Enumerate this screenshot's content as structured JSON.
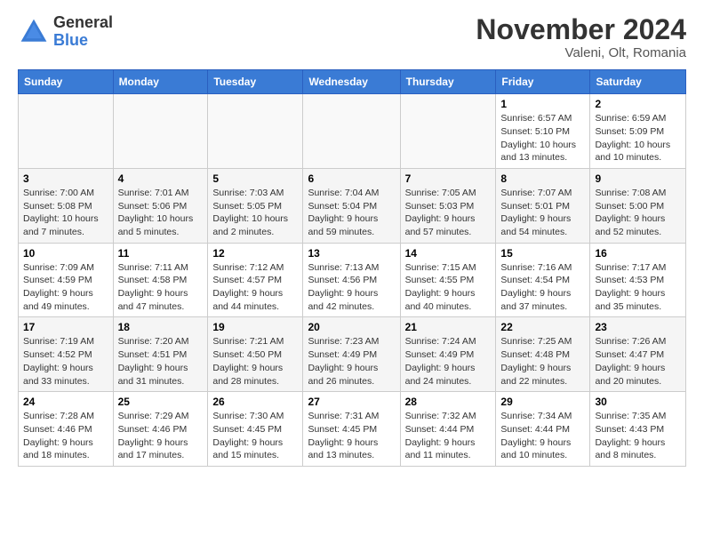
{
  "header": {
    "logo_general": "General",
    "logo_blue": "Blue",
    "month_title": "November 2024",
    "location": "Valeni, Olt, Romania"
  },
  "weekdays": [
    "Sunday",
    "Monday",
    "Tuesday",
    "Wednesday",
    "Thursday",
    "Friday",
    "Saturday"
  ],
  "weeks": [
    [
      {
        "day": "",
        "info": ""
      },
      {
        "day": "",
        "info": ""
      },
      {
        "day": "",
        "info": ""
      },
      {
        "day": "",
        "info": ""
      },
      {
        "day": "",
        "info": ""
      },
      {
        "day": "1",
        "info": "Sunrise: 6:57 AM\nSunset: 5:10 PM\nDaylight: 10 hours and 13 minutes."
      },
      {
        "day": "2",
        "info": "Sunrise: 6:59 AM\nSunset: 5:09 PM\nDaylight: 10 hours and 10 minutes."
      }
    ],
    [
      {
        "day": "3",
        "info": "Sunrise: 7:00 AM\nSunset: 5:08 PM\nDaylight: 10 hours and 7 minutes."
      },
      {
        "day": "4",
        "info": "Sunrise: 7:01 AM\nSunset: 5:06 PM\nDaylight: 10 hours and 5 minutes."
      },
      {
        "day": "5",
        "info": "Sunrise: 7:03 AM\nSunset: 5:05 PM\nDaylight: 10 hours and 2 minutes."
      },
      {
        "day": "6",
        "info": "Sunrise: 7:04 AM\nSunset: 5:04 PM\nDaylight: 9 hours and 59 minutes."
      },
      {
        "day": "7",
        "info": "Sunrise: 7:05 AM\nSunset: 5:03 PM\nDaylight: 9 hours and 57 minutes."
      },
      {
        "day": "8",
        "info": "Sunrise: 7:07 AM\nSunset: 5:01 PM\nDaylight: 9 hours and 54 minutes."
      },
      {
        "day": "9",
        "info": "Sunrise: 7:08 AM\nSunset: 5:00 PM\nDaylight: 9 hours and 52 minutes."
      }
    ],
    [
      {
        "day": "10",
        "info": "Sunrise: 7:09 AM\nSunset: 4:59 PM\nDaylight: 9 hours and 49 minutes."
      },
      {
        "day": "11",
        "info": "Sunrise: 7:11 AM\nSunset: 4:58 PM\nDaylight: 9 hours and 47 minutes."
      },
      {
        "day": "12",
        "info": "Sunrise: 7:12 AM\nSunset: 4:57 PM\nDaylight: 9 hours and 44 minutes."
      },
      {
        "day": "13",
        "info": "Sunrise: 7:13 AM\nSunset: 4:56 PM\nDaylight: 9 hours and 42 minutes."
      },
      {
        "day": "14",
        "info": "Sunrise: 7:15 AM\nSunset: 4:55 PM\nDaylight: 9 hours and 40 minutes."
      },
      {
        "day": "15",
        "info": "Sunrise: 7:16 AM\nSunset: 4:54 PM\nDaylight: 9 hours and 37 minutes."
      },
      {
        "day": "16",
        "info": "Sunrise: 7:17 AM\nSunset: 4:53 PM\nDaylight: 9 hours and 35 minutes."
      }
    ],
    [
      {
        "day": "17",
        "info": "Sunrise: 7:19 AM\nSunset: 4:52 PM\nDaylight: 9 hours and 33 minutes."
      },
      {
        "day": "18",
        "info": "Sunrise: 7:20 AM\nSunset: 4:51 PM\nDaylight: 9 hours and 31 minutes."
      },
      {
        "day": "19",
        "info": "Sunrise: 7:21 AM\nSunset: 4:50 PM\nDaylight: 9 hours and 28 minutes."
      },
      {
        "day": "20",
        "info": "Sunrise: 7:23 AM\nSunset: 4:49 PM\nDaylight: 9 hours and 26 minutes."
      },
      {
        "day": "21",
        "info": "Sunrise: 7:24 AM\nSunset: 4:49 PM\nDaylight: 9 hours and 24 minutes."
      },
      {
        "day": "22",
        "info": "Sunrise: 7:25 AM\nSunset: 4:48 PM\nDaylight: 9 hours and 22 minutes."
      },
      {
        "day": "23",
        "info": "Sunrise: 7:26 AM\nSunset: 4:47 PM\nDaylight: 9 hours and 20 minutes."
      }
    ],
    [
      {
        "day": "24",
        "info": "Sunrise: 7:28 AM\nSunset: 4:46 PM\nDaylight: 9 hours and 18 minutes."
      },
      {
        "day": "25",
        "info": "Sunrise: 7:29 AM\nSunset: 4:46 PM\nDaylight: 9 hours and 17 minutes."
      },
      {
        "day": "26",
        "info": "Sunrise: 7:30 AM\nSunset: 4:45 PM\nDaylight: 9 hours and 15 minutes."
      },
      {
        "day": "27",
        "info": "Sunrise: 7:31 AM\nSunset: 4:45 PM\nDaylight: 9 hours and 13 minutes."
      },
      {
        "day": "28",
        "info": "Sunrise: 7:32 AM\nSunset: 4:44 PM\nDaylight: 9 hours and 11 minutes."
      },
      {
        "day": "29",
        "info": "Sunrise: 7:34 AM\nSunset: 4:44 PM\nDaylight: 9 hours and 10 minutes."
      },
      {
        "day": "30",
        "info": "Sunrise: 7:35 AM\nSunset: 4:43 PM\nDaylight: 9 hours and 8 minutes."
      }
    ]
  ]
}
